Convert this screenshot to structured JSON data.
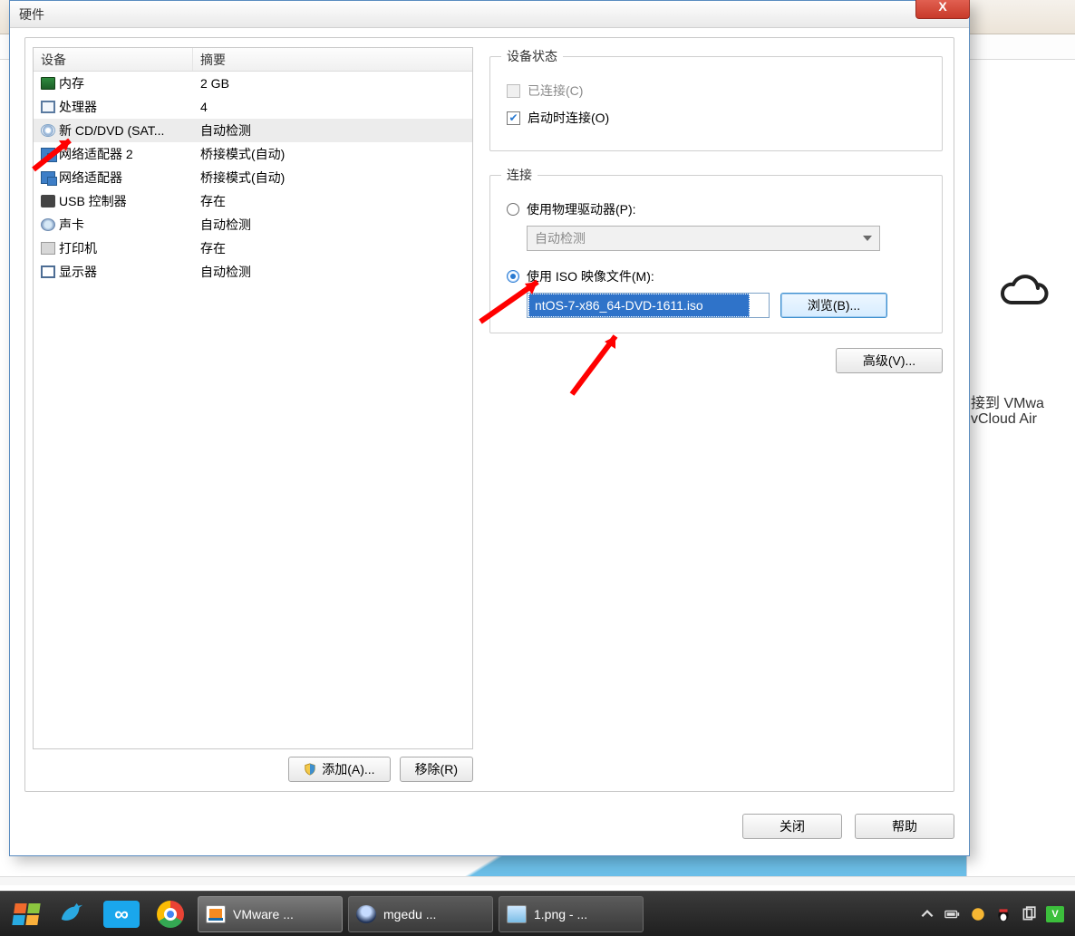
{
  "window": {
    "title": "硬件",
    "close_x": "X"
  },
  "device_list": {
    "headers": {
      "device": "设备",
      "summary": "摘要"
    },
    "rows": [
      {
        "icon": "mem",
        "name": "内存",
        "summary": "2 GB"
      },
      {
        "icon": "cpu",
        "name": "处理器",
        "summary": "4"
      },
      {
        "icon": "cd",
        "name": "新 CD/DVD (SAT...",
        "summary": "自动检测",
        "selected": true
      },
      {
        "icon": "net",
        "name": "网络适配器 2",
        "summary": "桥接模式(自动)"
      },
      {
        "icon": "net",
        "name": "网络适配器",
        "summary": "桥接模式(自动)"
      },
      {
        "icon": "usb",
        "name": "USB 控制器",
        "summary": "存在"
      },
      {
        "icon": "snd",
        "name": "声卡",
        "summary": "自动检测"
      },
      {
        "icon": "prn",
        "name": "打印机",
        "summary": "存在"
      },
      {
        "icon": "dsp",
        "name": "显示器",
        "summary": "自动检测"
      }
    ],
    "add_label": "添加(A)...",
    "remove_label": "移除(R)"
  },
  "status_group": {
    "legend": "设备状态",
    "connected_label": "已连接(C)",
    "connect_at_poweron_label": "启动时连接(O)"
  },
  "connection_group": {
    "legend": "连接",
    "physical_label": "使用物理驱动器(P):",
    "physical_dropdown_value": "自动检测",
    "iso_label": "使用 ISO 映像文件(M):",
    "iso_value": "ntOS-7-x86_64-DVD-1611.iso",
    "browse_label": "浏览(B)...",
    "advanced_label": "高级(V)..."
  },
  "footer": {
    "close_label": "关闭",
    "help_label": "帮助"
  },
  "backdrop": {
    "line1": "接到 VMwa",
    "line2": "vCloud Air"
  },
  "taskbar": {
    "tasks": [
      {
        "icon": "vm",
        "label": "VMware ..."
      },
      {
        "icon": "avatar",
        "label": "mgedu ..."
      },
      {
        "icon": "pic",
        "label": "1.png - ..."
      }
    ]
  }
}
